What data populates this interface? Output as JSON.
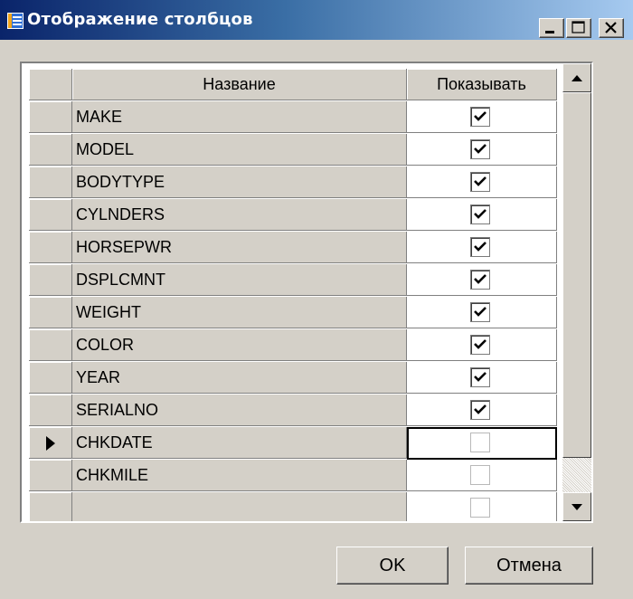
{
  "window": {
    "title": "Отображение столбцов",
    "icon": "table-grid-icon",
    "controls": [
      "minimize-icon",
      "maximize-icon",
      "close-icon"
    ]
  },
  "grid": {
    "columns": [
      "Название",
      "Показывать"
    ],
    "rows": [
      {
        "name": "MAKE",
        "show": true
      },
      {
        "name": "MODEL",
        "show": true
      },
      {
        "name": "BODYTYPE",
        "show": true
      },
      {
        "name": "CYLNDERS",
        "show": true
      },
      {
        "name": "HORSEPWR",
        "show": true
      },
      {
        "name": "DSPLCMNT",
        "show": true
      },
      {
        "name": "WEIGHT",
        "show": true
      },
      {
        "name": "COLOR",
        "show": true
      },
      {
        "name": "YEAR",
        "show": true
      },
      {
        "name": "SERIALNO",
        "show": true
      },
      {
        "name": "CHKDATE",
        "show": false,
        "current": true
      },
      {
        "name": "CHKMILE",
        "show": false
      },
      {
        "name": "",
        "show": false
      }
    ]
  },
  "buttons": {
    "ok": "OK",
    "cancel": "Отмена"
  },
  "colors": {
    "title_start": "#0a246a",
    "title_end": "#a6caf0",
    "face": "#d4d0c8"
  }
}
